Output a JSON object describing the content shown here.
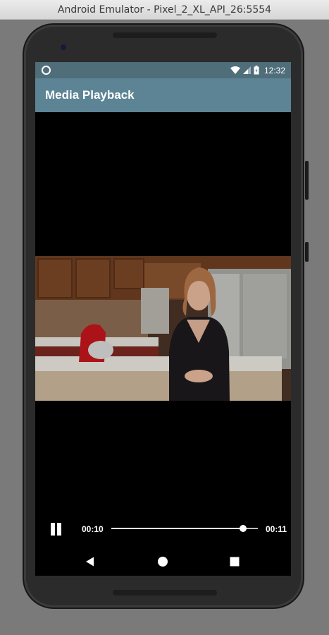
{
  "window": {
    "title": "Android Emulator - Pixel_2_XL_API_26:5554"
  },
  "status_bar": {
    "time": "12:32",
    "icons": [
      "notification-icon",
      "wifi-icon",
      "signal-icon",
      "battery-icon"
    ]
  },
  "app_bar": {
    "title": "Media Playback"
  },
  "player": {
    "current_time": "00:10",
    "total_time": "00:11",
    "progress_fraction": 0.9,
    "state_icon": "pause-icon"
  },
  "navigation": {
    "icons": [
      "back-icon",
      "home-icon",
      "recents-icon"
    ]
  },
  "colors": {
    "status_bar": "#4f6e7a",
    "app_bar": "#5c8495",
    "screen": "#000000"
  }
}
